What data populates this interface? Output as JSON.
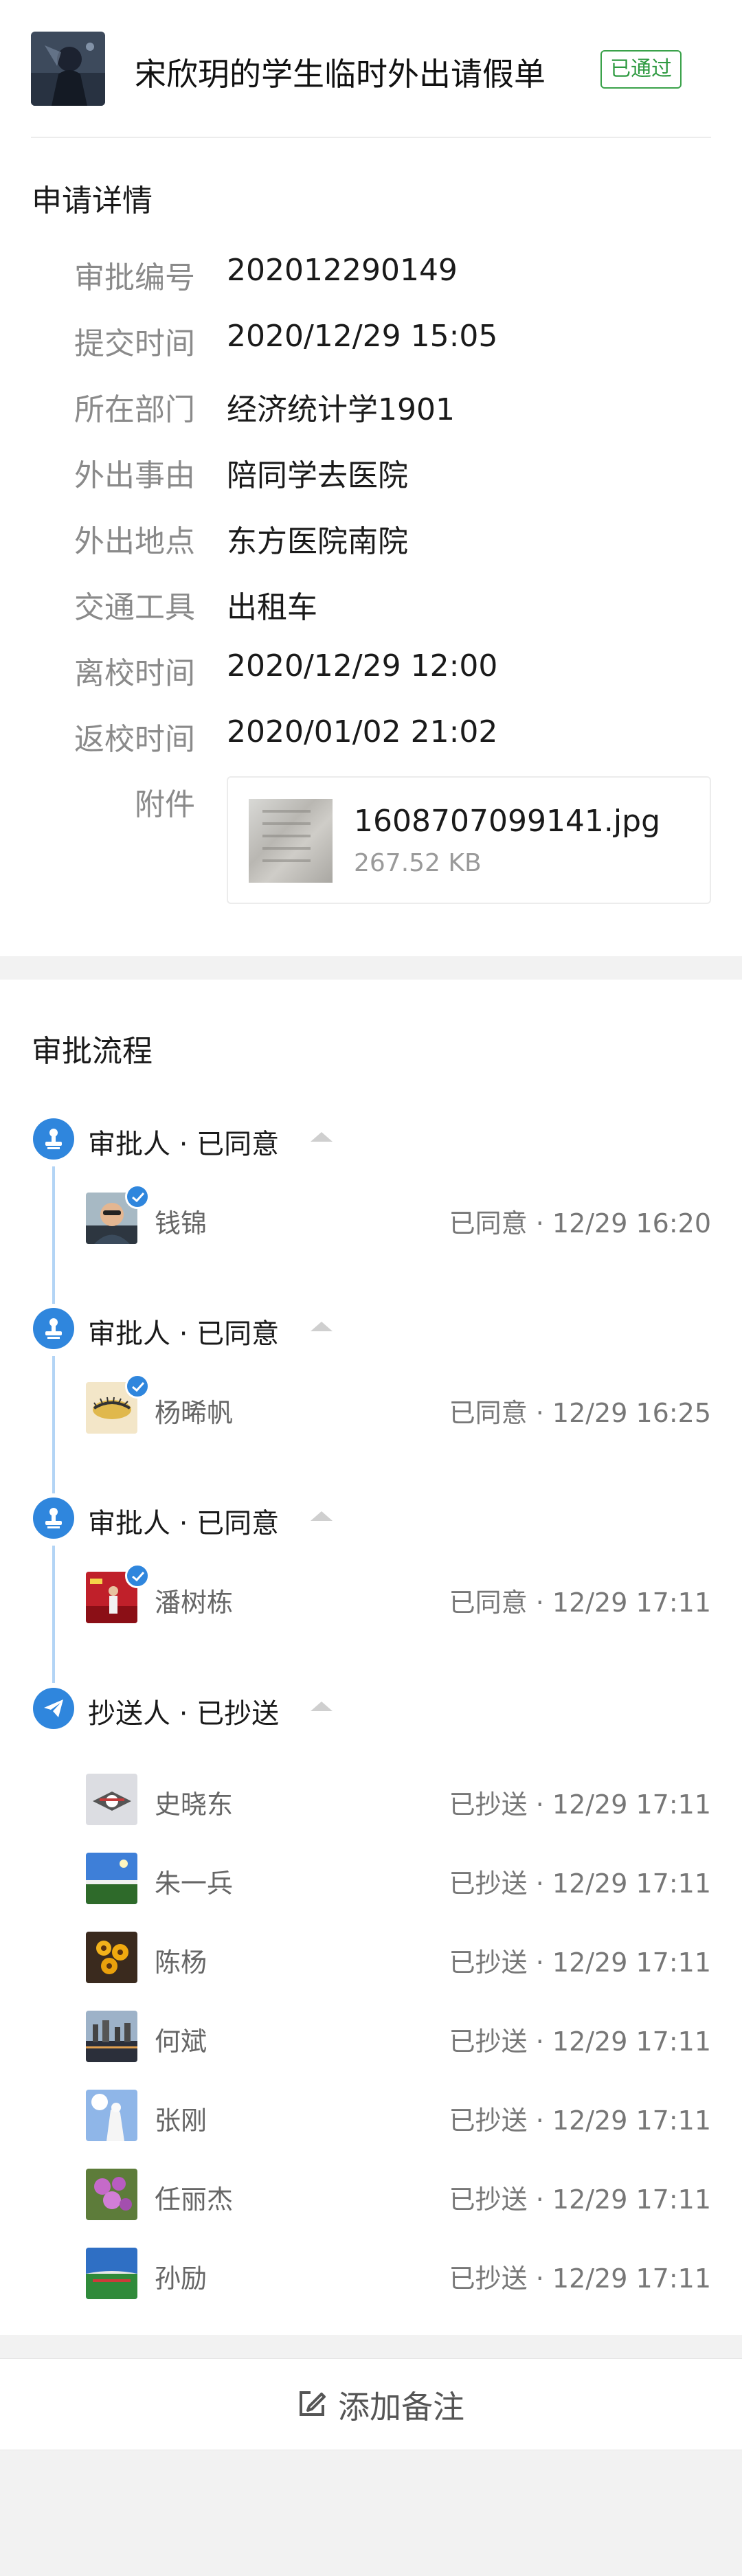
{
  "header": {
    "title": "宋欣玥的学生临时外出请假单",
    "status_badge": "已通过",
    "avatar_icon": "anime-character-avatar"
  },
  "details": {
    "section_title": "申请详情",
    "fields": [
      {
        "label": "审批编号",
        "value": "202012290149"
      },
      {
        "label": "提交时间",
        "value": "2020/12/29 15:05"
      },
      {
        "label": "所在部门",
        "value": "经济统计学1901"
      },
      {
        "label": "外出事由",
        "value": "陪同学去医院"
      },
      {
        "label": "外出地点",
        "value": "东方医院南院"
      },
      {
        "label": "交通工具",
        "value": "出租车"
      },
      {
        "label": "离校时间",
        "value": "2020/12/29 12:00"
      },
      {
        "label": "返校时间",
        "value": "2020/01/02 21:02"
      }
    ],
    "attachment": {
      "label": "附件",
      "file_name": "1608707099141.jpg",
      "file_size": "267.52 KB"
    }
  },
  "flow": {
    "section_title": "审批流程",
    "colors": {
      "accent": "#2f86dd",
      "line": "#b3d4f5"
    },
    "stages": [
      {
        "title": "审批人 · 已同意",
        "icon": "stamp-icon",
        "people": [
          {
            "name": "钱锦",
            "status": "已同意 · 12/29 16:20",
            "approved": true
          }
        ]
      },
      {
        "title": "审批人 · 已同意",
        "icon": "stamp-icon",
        "people": [
          {
            "name": "杨晞帆",
            "status": "已同意 · 12/29 16:25",
            "approved": true
          }
        ]
      },
      {
        "title": "审批人 · 已同意",
        "icon": "stamp-icon",
        "people": [
          {
            "name": "潘树栋",
            "status": "已同意 · 12/29 17:11",
            "approved": true
          }
        ]
      },
      {
        "title": "抄送人 · 已抄送",
        "icon": "paper-plane-icon",
        "people": [
          {
            "name": "史晓东",
            "status": "已抄送 · 12/29 17:11"
          },
          {
            "name": "朱一兵",
            "status": "已抄送 · 12/29 17:11"
          },
          {
            "name": "陈杨",
            "status": "已抄送 · 12/29 17:11"
          },
          {
            "name": "何斌",
            "status": "已抄送 · 12/29 17:11"
          },
          {
            "name": "张刚",
            "status": "已抄送 · 12/29 17:11"
          },
          {
            "name": "任丽杰",
            "status": "已抄送 · 12/29 17:11"
          },
          {
            "name": "孙励",
            "status": "已抄送 · 12/29 17:11"
          }
        ]
      }
    ]
  },
  "footer": {
    "add_note_label": "添加备注",
    "icon": "edit-icon"
  }
}
